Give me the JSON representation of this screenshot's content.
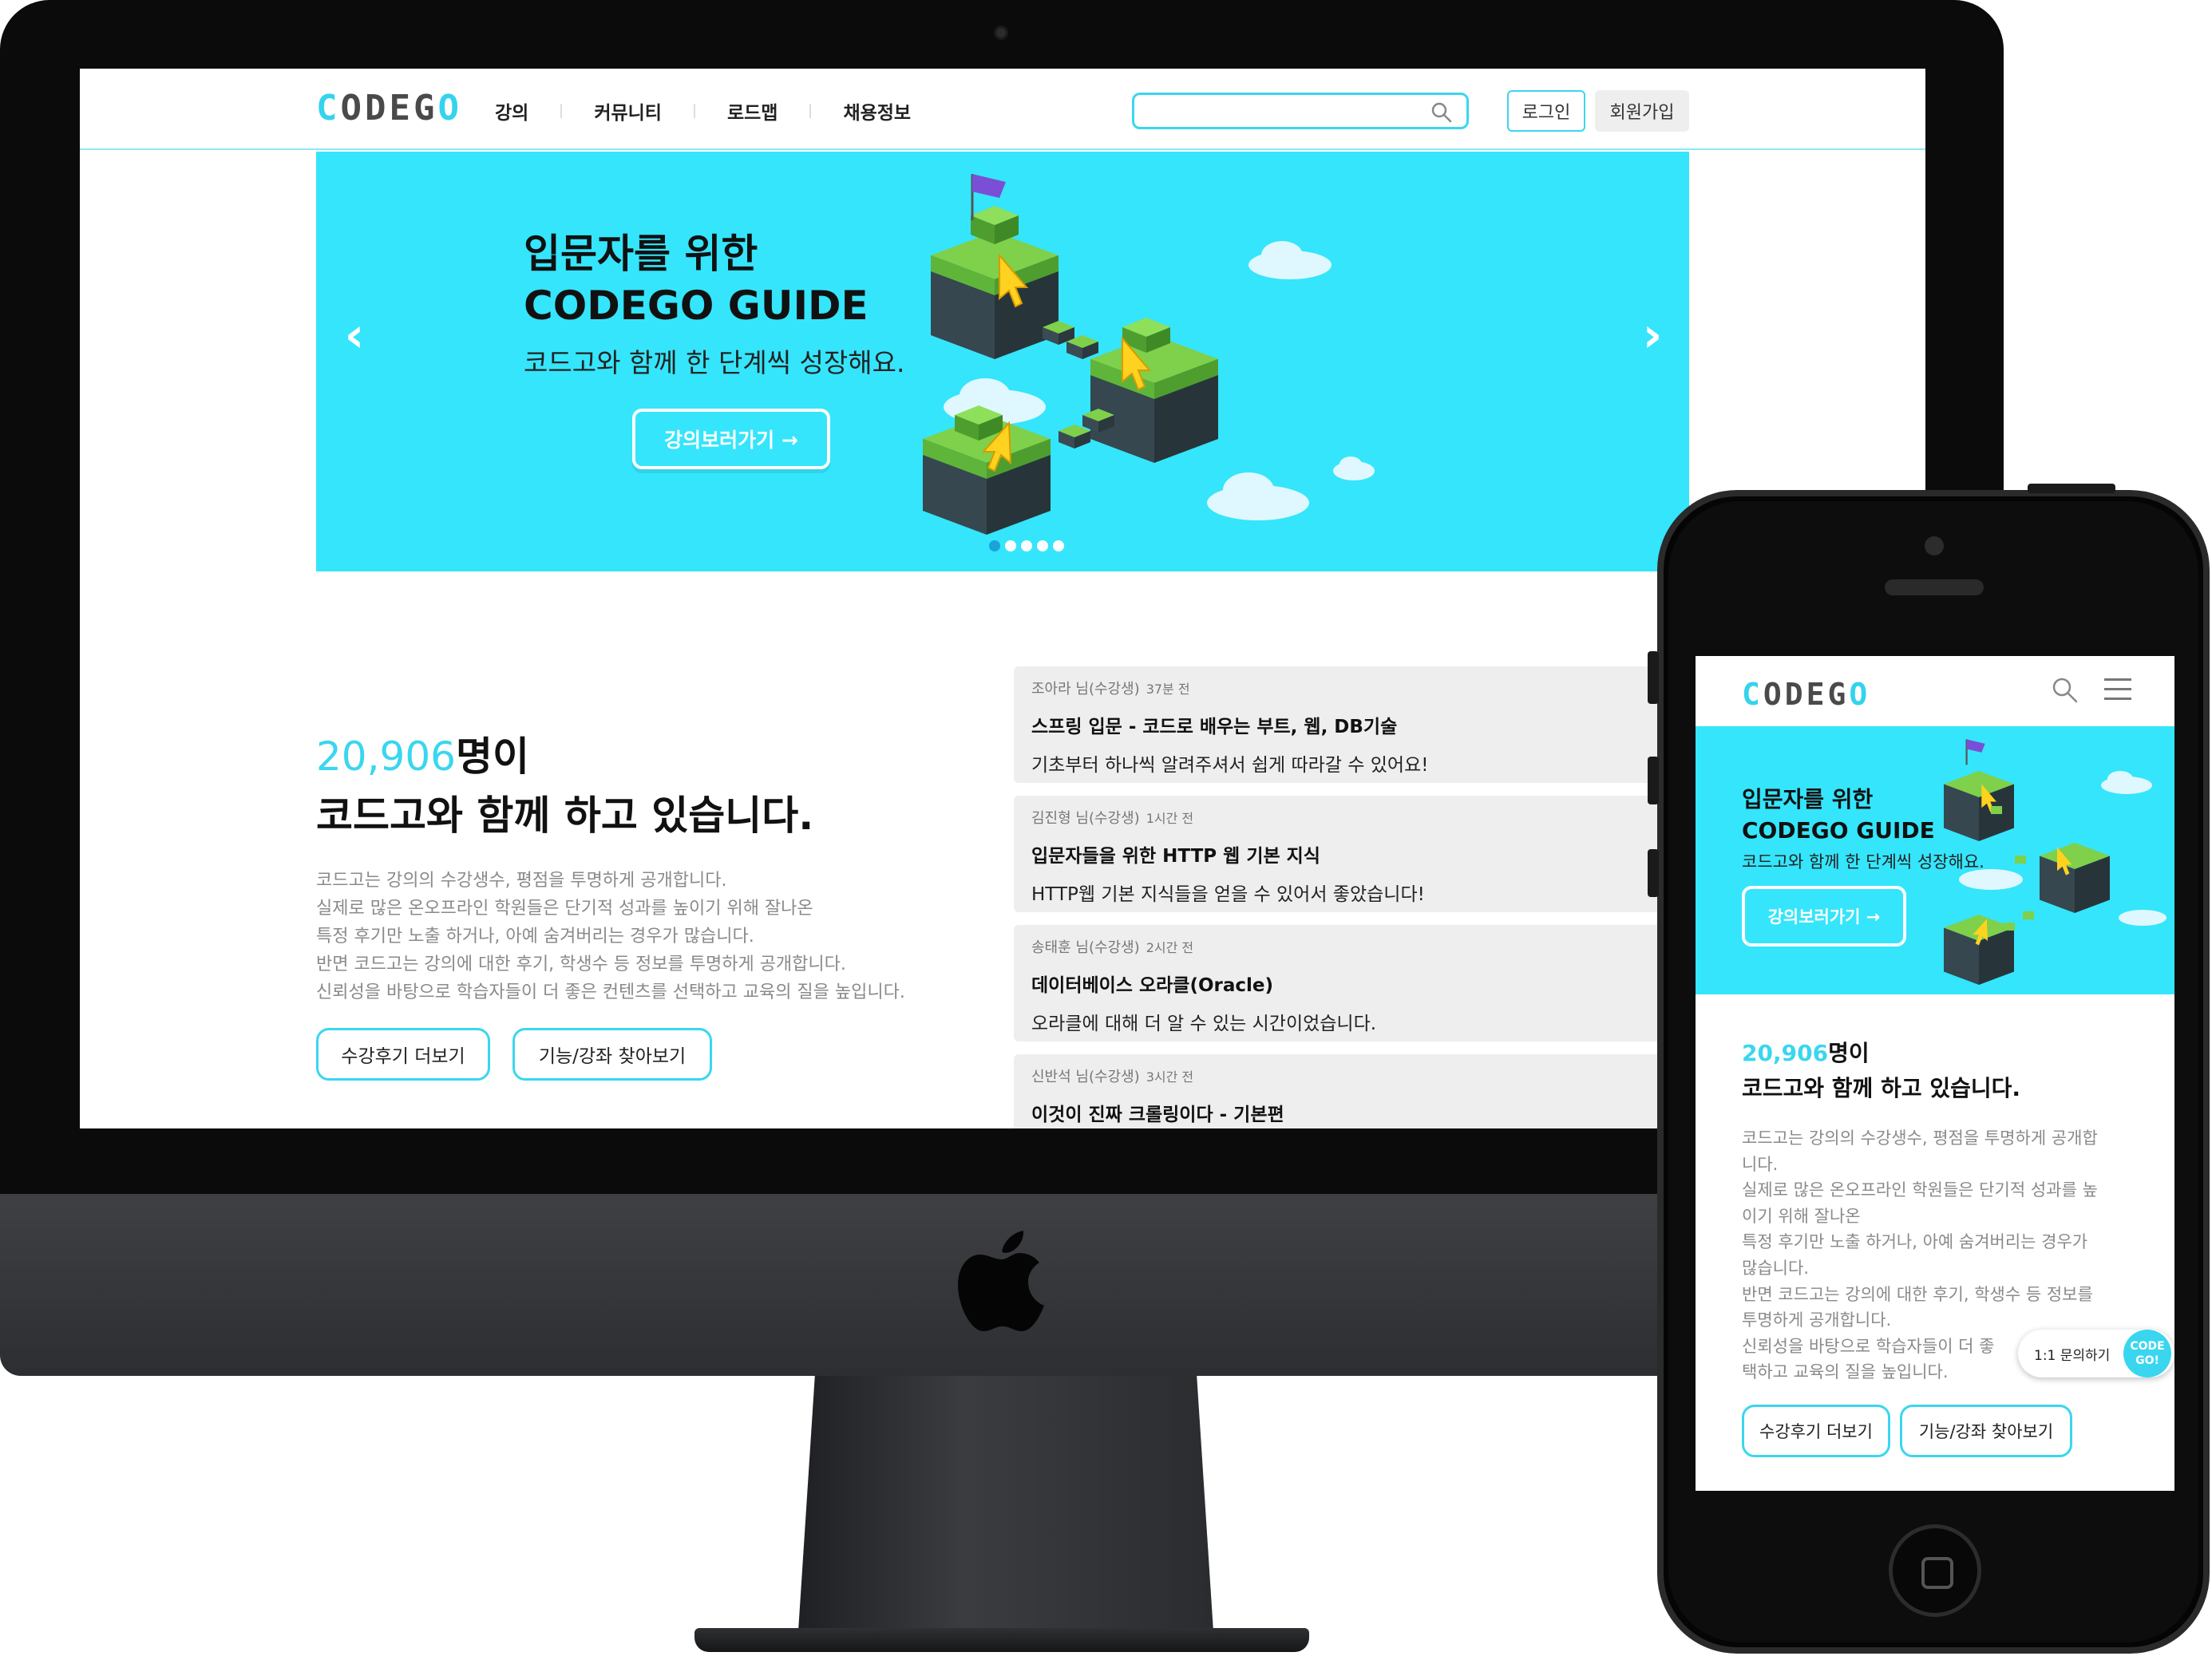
{
  "brand": {
    "logo_cyan_part": "C",
    "logo_gray_part": "ODEG",
    "logo_end": "O",
    "accent_color": "#3ad6ef",
    "banner_color": "#35e5fb"
  },
  "desktop": {
    "nav": [
      "강의",
      "커뮤니티",
      "로드맵",
      "채용정보"
    ],
    "search": {
      "placeholder": "",
      "icon": "search-icon"
    },
    "login_label": "로그인",
    "signup_label": "회원가입",
    "hero": {
      "title_line1": "입문자를 위한",
      "title_line2": "CODEGO GUIDE",
      "subtitle": "코드고와 함께 한 단계씩 성장해요.",
      "cta": "강의보러가기 →",
      "prev_icon": "‹",
      "next_icon": "›",
      "slide_count": 5,
      "active_slide": 1
    },
    "stats": {
      "count": "20,906",
      "count_suffix": "명이",
      "headline": "코드고와 함께 하고 있습니다."
    },
    "description": [
      "코드고는 강의의 수강생수, 평점을 투명하게 공개합니다.",
      "실제로 많은 온오프라인 학원들은 단기적 성과를 높이기 위해 잘나온",
      "특정 후기만 노출 하거나, 아예 숨겨버리는 경우가 많습니다.",
      "반면 코드고는 강의에 대한 후기, 학생수 등 정보를 투명하게 공개합니다.",
      "신뢰성을 바탕으로 학습자들이 더 좋은 컨텐츠를 선택하고 교육의 질을 높입니다."
    ],
    "buttons": {
      "reviews_more": "수강후기 더보기",
      "find_features": "기능/강좌 찾아보기"
    },
    "reviews": [
      {
        "author": "조아라 님(수강생)",
        "time": "37분 전",
        "title": "스프링 입문 - 코드로 배우는 부트, 웹, DB기술",
        "body": "기초부터 하나씩 알려주셔서 쉽게 따라갈 수 있어요!"
      },
      {
        "author": "김진형 님(수강생)",
        "time": "1시간 전",
        "title": "입문자들을 위한 HTTP 웹 기본 지식",
        "body": "HTTP웹 기본 지식들을 얻을 수 있어서 좋았습니다!"
      },
      {
        "author": "송태훈 님(수강생)",
        "time": "2시간 전",
        "title": "데이터베이스 오라클(Oracle)",
        "body": "오라클에 대해 더 알 수 있는 시간이었습니다."
      },
      {
        "author": "신반석 님(수강생)",
        "time": "3시간 전",
        "title": "이것이 진짜 크롤링이다 - 기본편",
        "body": ""
      }
    ]
  },
  "mobile": {
    "hero": {
      "title_line1": "입문자를 위한",
      "title_line2": "CODEGO GUIDE",
      "subtitle": "코드고와 함께 한 단계씩 성장해요.",
      "cta": "강의보러가기 →"
    },
    "stats": {
      "count": "20,906",
      "count_suffix": "명이",
      "headline": "코드고와 함께 하고 있습니다."
    },
    "description_lines": [
      "코드고는 강의의 수강생수, 평점을 투명하게 공개합",
      "니다.",
      "실제로 많은 온오프라인 학원들은 단기적 성과를 높",
      "이기 위해 잘나온",
      "특정 후기만 노출 하거나, 아예 숨겨버리는 경우가",
      "많습니다.",
      "반면 코드고는 강의에 대한 후기, 학생수 등 정보를",
      "투명하게 공개합니다.",
      "신뢰성을 바탕으로 학습자들이 더 좋",
      "택하고 교육의 질을 높입니다."
    ],
    "buttons": {
      "reviews_more": "수강후기 더보기",
      "find_features": "기능/강좌 찾아보기"
    },
    "chat": {
      "label": "1:1 문의하기",
      "badge_line1": "CODE",
      "badge_line2": "GO!"
    }
  }
}
